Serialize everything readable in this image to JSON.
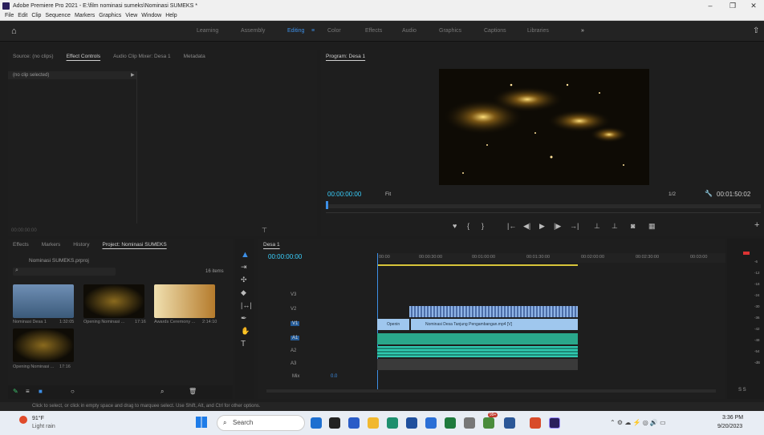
{
  "window": {
    "title": "Adobe Premiere Pro 2021 - E:\\film nominasi sumeks\\Nominasi SUMEKS *"
  },
  "menu": [
    "File",
    "Edit",
    "Clip",
    "Sequence",
    "Markers",
    "Graphics",
    "View",
    "Window",
    "Help"
  ],
  "workspaces": [
    "Learning",
    "Assembly",
    "Editing",
    "Color",
    "Effects",
    "Audio",
    "Graphics",
    "Captions",
    "Libraries"
  ],
  "active_workspace": "Editing",
  "source_panel": {
    "tabs": [
      "Source: (no clips)",
      "Effect Controls",
      "Audio Clip Mixer: Desa 1",
      "Metadata"
    ],
    "no_clip": "(no clip selected)",
    "timecode": "00:00:00:00"
  },
  "program": {
    "tab": "Program: Desa 1",
    "timecode": "00:00:00:00",
    "fit": "Fit",
    "quality": "1/2",
    "duration": "00:01:50:02"
  },
  "project": {
    "tabs": [
      "Effects",
      "Markers",
      "History",
      "Project: Nominasi SUMEKS"
    ],
    "file": "Nominasi SUMEKS.prproj",
    "items": "16 items",
    "thumbs": [
      {
        "name": "Nominasi Desa 1",
        "dur": "1:32:05"
      },
      {
        "name": "Opening Nominasi ...",
        "dur": "17:16"
      },
      {
        "name": "Awards Ceremony ...",
        "dur": "2:14:10"
      },
      {
        "name": "Opening Nominasi ...",
        "dur": "17:16"
      }
    ]
  },
  "timeline": {
    "tab": "Desa 1",
    "timecode": "00:00:00:00",
    "ruler": [
      "00:00",
      "00:00:30:00",
      "00:01:00:00",
      "00:01:30:00",
      "00:02:00:00",
      "00:02:30:00",
      "00:03:00"
    ],
    "tracks": [
      "V3",
      "V2",
      "V1",
      "A1",
      "A2",
      "A3"
    ],
    "mix": "Mix",
    "mix_val": "0.0",
    "clips": {
      "v1a": "Openin",
      "v1b": "Nominasi Desa Tanjung Pengambangan.mp4 [V]"
    }
  },
  "meter": {
    "labels": [
      "-6",
      "-12",
      "-18",
      "-24",
      "-30",
      "-36",
      "-42",
      "-48",
      "-54",
      "-dB"
    ],
    "solo": "S  S"
  },
  "status": "Click to select, or click in empty space and drag to marquee select. Use Shift, Alt, and Ctrl for other options.",
  "taskbar": {
    "temp": "91°F",
    "weather": "Light rain",
    "search": "Search",
    "time": "3:36 PM",
    "date": "9/20/2023",
    "badge": "99+"
  }
}
